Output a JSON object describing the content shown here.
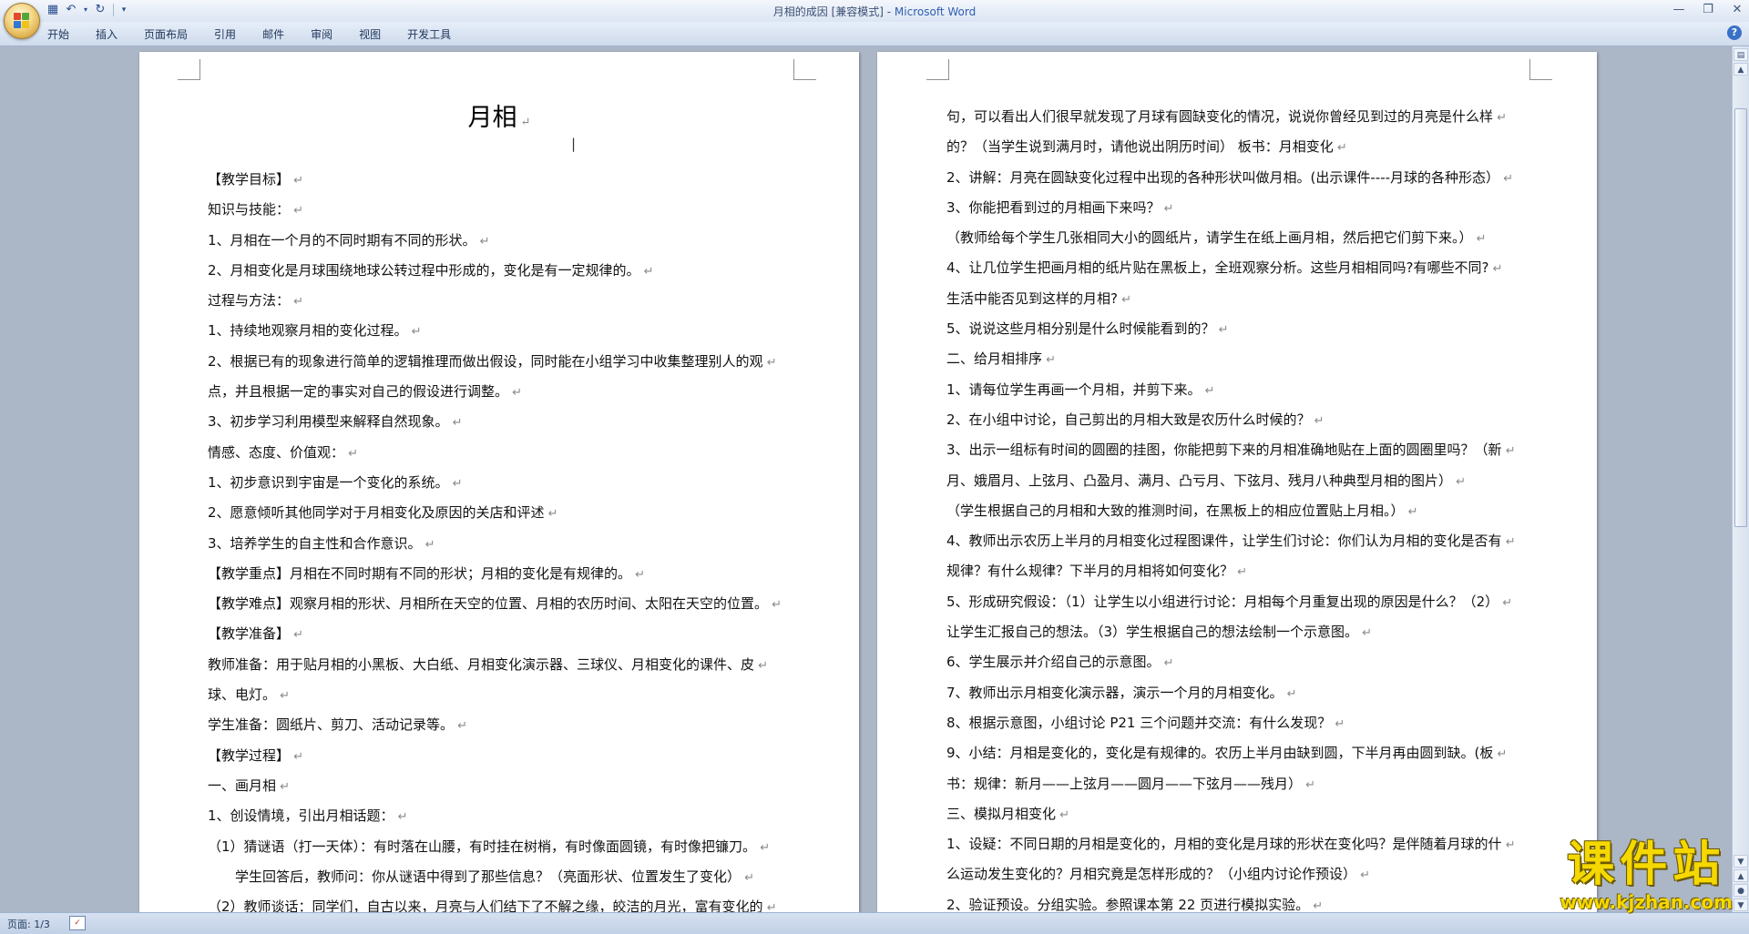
{
  "window": {
    "title_doc": "月相的成因 [兼容模式] - ",
    "title_app": "Microsoft Word"
  },
  "quick_access": [
    "save-icon",
    "undo-icon",
    "redo-icon",
    "customize-icon"
  ],
  "ribbon": {
    "tabs": [
      "开始",
      "插入",
      "页面布局",
      "引用",
      "邮件",
      "审阅",
      "视图",
      "开发工具"
    ]
  },
  "document": {
    "title": "月相",
    "left_lines": [
      "【教学目标】",
      "知识与技能：",
      "1、月相在一个月的不同时期有不同的形状。",
      "2、月相变化是月球围绕地球公转过程中形成的，变化是有一定规律的。",
      "过程与方法：",
      "1、持续地观察月相的变化过程。",
      "2、根据已有的现象进行简单的逻辑推理而做出假设，同时能在小组学习中收集整理别人的观",
      "点，并且根据一定的事实对自己的假设进行调整。",
      "3、初步学习利用模型来解释自然现象。",
      "情感、态度、价值观：",
      "1、初步意识到宇宙是一个变化的系统。",
      "2、愿意倾听其他同学对于月相变化及原因的关店和评述",
      "3、培养学生的自主性和合作意识。",
      "【教学重点】月相在不同时期有不同的形状；月相的变化是有规律的。",
      "【教学难点】观察月相的形状、月相所在天空的位置、月相的农历时间、太阳在天空的位置。",
      "【教学准备】",
      "教师准备：用于贴月相的小黑板、大白纸、月相变化演示器、三球仪、月相变化的课件、皮",
      "球、电灯。",
      "学生准备：圆纸片、剪刀、活动记录等。",
      "【教学过程】",
      "一、画月相",
      "1、创设情境，引出月相话题：",
      "（1）猜谜语（打一天体）：有时落在山腰，有时挂在树梢，有时像面圆镜，有时像把镰刀。",
      "　　学生回答后，教师问：你从谜语中得到了那些信息？（亮面形状、位置发生了变化）",
      "（2）教师谈话：同学们，自古以来，月亮与人们结下了不解之缘，皎洁的月光，富有变化的"
    ],
    "right_lines": [
      "句，可以看出人们很早就发现了月球有圆缺变化的情况，说说你曾经见到过的月亮是什么样",
      "的？（当学生说到满月时，请他说出阴历时间） 板书：月相变化",
      "2、讲解：月亮在圆缺变化过程中出现的各种形状叫做月相。(出示课件----月球的各种形态）",
      "3、你能把看到过的月相画下来吗？",
      "（教师给每个学生几张相同大小的圆纸片，请学生在纸上画月相，然后把它们剪下来。）",
      "4、让几位学生把画月相的纸片贴在黑板上，全班观察分析。这些月相相同吗?有哪些不同?",
      "生活中能否见到这样的月相?",
      "5、说说这些月相分别是什么时候能看到的？",
      "二、给月相排序",
      "1、请每位学生再画一个月相，并剪下来。",
      "2、在小组中讨论，自己剪出的月相大致是农历什么时候的？",
      "3、出示一组标有时间的圆圈的挂图，你能把剪下来的月相准确地贴在上面的圆圈里吗？（新",
      "月、娥眉月、上弦月、凸盈月、满月、凸亏月、下弦月、残月八种典型月相的图片）",
      "（学生根据自己的月相和大致的推测时间，在黑板上的相应位置贴上月相。）",
      "4、教师出示农历上半月的月相变化过程图课件，让学生们讨论：你们认为月相的变化是否有",
      "规律？有什么规律？下半月的月相将如何变化？",
      "5、形成研究假设：（1）让学生以小组进行讨论：月相每个月重复出现的原因是什么？（2）",
      "让学生汇报自己的想法。（3）学生根据自己的想法绘制一个示意图。",
      "6、学生展示并介绍自己的示意图。",
      "7、教师出示月相变化演示器，演示一个月的月相变化。",
      "8、根据示意图，小组讨论 P21 三个问题并交流：有什么发现？",
      "9、小结：月相是变化的，变化是有规律的。农历上半月由缺到圆，下半月再由圆到缺。(板",
      "书：规律：新月——上弦月——圆月——下弦月——残月）",
      "三、模拟月相变化",
      "1、设疑：不同日期的月相是变化的，月相的变化是月球的形状在变化吗？是伴随着月球的什",
      "么运动发生变化的？月相究竟是怎样形成的？（小组内讨论作预设）",
      "2、验证预设。分组实验。参照课本第 22 页进行模拟实验。"
    ]
  },
  "statusbar": {
    "page_count": "页面: 1/3"
  },
  "watermark": {
    "text": "课件站",
    "url": "www.kjzhan.com"
  }
}
